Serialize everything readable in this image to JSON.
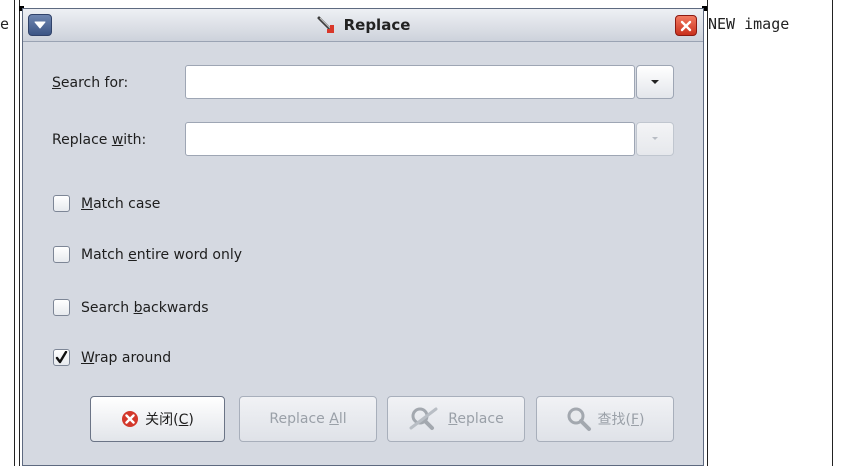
{
  "background": {
    "left_fragment": "e",
    "right_text": "NEW image"
  },
  "dialog": {
    "title": "Replace",
    "search_label": "Search for:",
    "search_value": "",
    "replace_label": "Replace with:",
    "replace_value": "",
    "options": [
      {
        "label": "Match case",
        "checked": false
      },
      {
        "label": "Match entire word only",
        "checked": false
      },
      {
        "label": "Search backwards",
        "checked": false
      },
      {
        "label": "Wrap around",
        "checked": true
      }
    ],
    "buttons": {
      "close": "关闭(C)",
      "replace_all": "Replace All",
      "replace": "Replace",
      "find": "查找(F)"
    }
  },
  "icons": {
    "window_menu": "chevron-down-icon",
    "title": "pencil-icon",
    "close_window": "close-icon",
    "close_button": "cancel-circle-icon",
    "replace_button": "find-replace-icon",
    "find_button": "magnifier-icon"
  },
  "colors": {
    "dialog_bg": "#d5d9e1",
    "close_red": "#d3382b",
    "window_button_blue": "#3c5585"
  }
}
